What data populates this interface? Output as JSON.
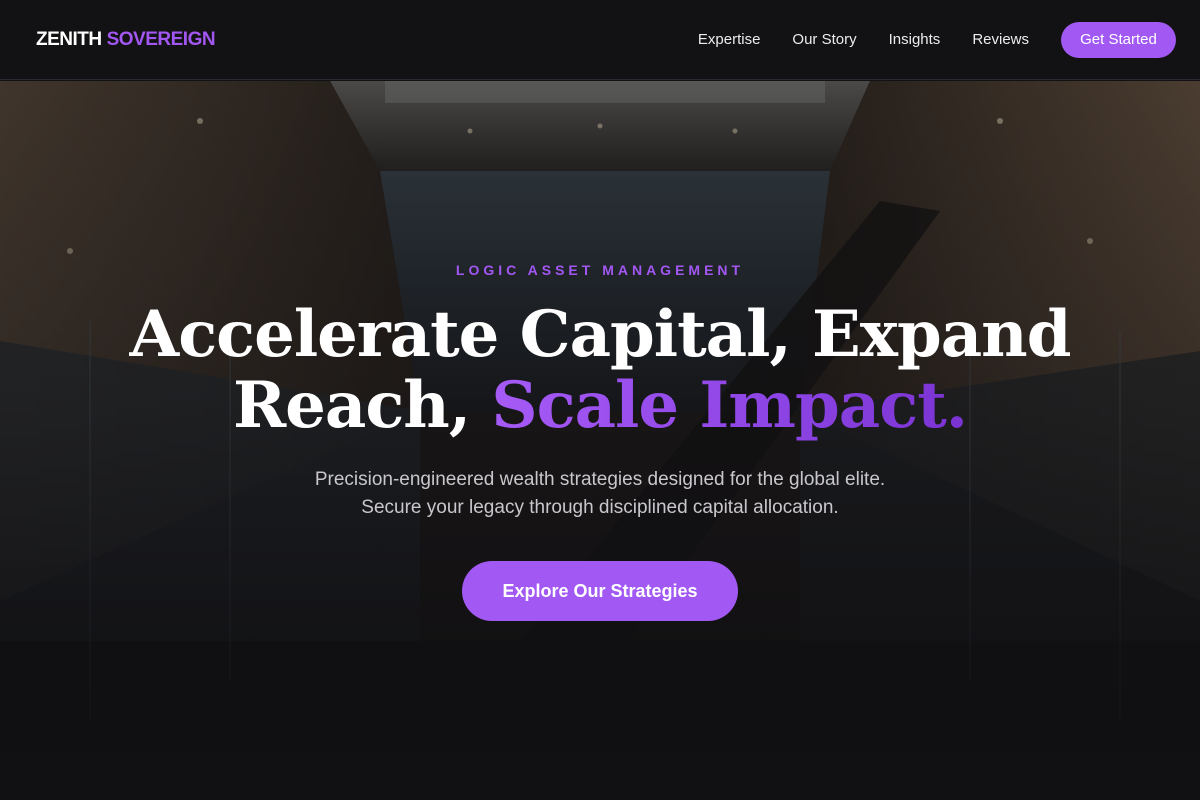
{
  "brand": {
    "part1": "ZENITH",
    "part2": "SOVEREIGN"
  },
  "nav": {
    "links": [
      {
        "label": "Expertise"
      },
      {
        "label": "Our Story"
      },
      {
        "label": "Insights"
      },
      {
        "label": "Reviews"
      }
    ],
    "cta_label": "Get Started"
  },
  "hero": {
    "eyebrow": "LOGIC ASSET MANAGEMENT",
    "headline_line1": "Accelerate Capital, Expand",
    "headline_line2_plain": "Reach,",
    "headline_line2_accent": "Scale Impact.",
    "subtext_line1": "Precision-engineered wealth strategies designed for the global elite.",
    "subtext_line2": "Secure your legacy through disciplined capital allocation.",
    "cta_label": "Explore Our Strategies"
  },
  "colors": {
    "accent": "#a259f4",
    "nav_background": "#121113",
    "page_background": "#111013"
  }
}
